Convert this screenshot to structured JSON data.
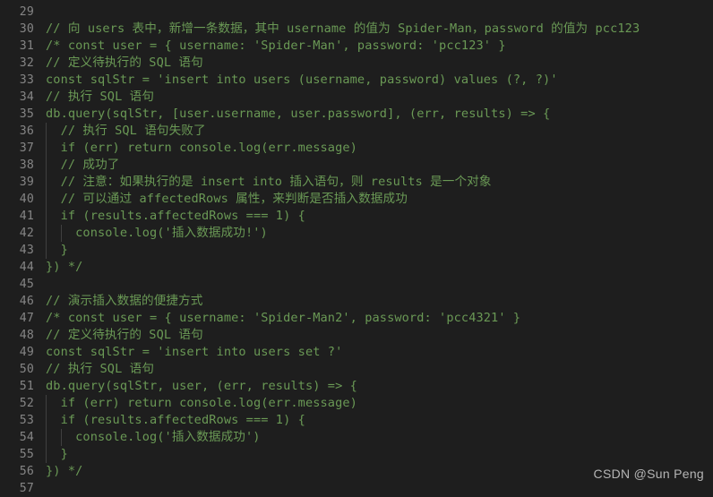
{
  "editor": {
    "theme": "dark-plus",
    "background_color": "#1e1e1e",
    "comment_color": "#6a9955",
    "line_number_color": "#858585",
    "indent_guide_color": "#404040",
    "first_line_number": 29,
    "lines": [
      {
        "number": "29",
        "text": "",
        "indent_guides": 0
      },
      {
        "number": "30",
        "text": "// 向 users 表中，新增一条数据，其中 username 的值为 Spider-Man，password 的值为 pcc123",
        "indent_guides": 0
      },
      {
        "number": "31",
        "text": "/* const user = { username: 'Spider-Man', password: 'pcc123' }",
        "indent_guides": 0
      },
      {
        "number": "32",
        "text": "// 定义待执行的 SQL 语句",
        "indent_guides": 0
      },
      {
        "number": "33",
        "text": "const sqlStr = 'insert into users (username, password) values (?, ?)'",
        "indent_guides": 0
      },
      {
        "number": "34",
        "text": "// 执行 SQL 语句",
        "indent_guides": 0
      },
      {
        "number": "35",
        "text": "db.query(sqlStr, [user.username, user.password], (err, results) => {",
        "indent_guides": 0
      },
      {
        "number": "36",
        "text": "  // 执行 SQL 语句失败了",
        "indent_guides": 1
      },
      {
        "number": "37",
        "text": "  if (err) return console.log(err.message)",
        "indent_guides": 1
      },
      {
        "number": "38",
        "text": "  // 成功了",
        "indent_guides": 1
      },
      {
        "number": "39",
        "text": "  // 注意：如果执行的是 insert into 插入语句，则 results 是一个对象",
        "indent_guides": 1
      },
      {
        "number": "40",
        "text": "  // 可以通过 affectedRows 属性，来判断是否插入数据成功",
        "indent_guides": 1
      },
      {
        "number": "41",
        "text": "  if (results.affectedRows === 1) {",
        "indent_guides": 1
      },
      {
        "number": "42",
        "text": "    console.log('插入数据成功!')",
        "indent_guides": 2
      },
      {
        "number": "43",
        "text": "  }",
        "indent_guides": 1
      },
      {
        "number": "44",
        "text": "}) */",
        "indent_guides": 0
      },
      {
        "number": "45",
        "text": "",
        "indent_guides": 0
      },
      {
        "number": "46",
        "text": "// 演示插入数据的便捷方式",
        "indent_guides": 0
      },
      {
        "number": "47",
        "text": "/* const user = { username: 'Spider-Man2', password: 'pcc4321' }",
        "indent_guides": 0
      },
      {
        "number": "48",
        "text": "// 定义待执行的 SQL 语句",
        "indent_guides": 0
      },
      {
        "number": "49",
        "text": "const sqlStr = 'insert into users set ?'",
        "indent_guides": 0
      },
      {
        "number": "50",
        "text": "// 执行 SQL 语句",
        "indent_guides": 0
      },
      {
        "number": "51",
        "text": "db.query(sqlStr, user, (err, results) => {",
        "indent_guides": 0
      },
      {
        "number": "52",
        "text": "  if (err) return console.log(err.message)",
        "indent_guides": 1
      },
      {
        "number": "53",
        "text": "  if (results.affectedRows === 1) {",
        "indent_guides": 1
      },
      {
        "number": "54",
        "text": "    console.log('插入数据成功')",
        "indent_guides": 2
      },
      {
        "number": "55",
        "text": "  }",
        "indent_guides": 1
      },
      {
        "number": "56",
        "text": "}) */",
        "indent_guides": 0
      },
      {
        "number": "57",
        "text": "",
        "indent_guides": 0
      }
    ]
  },
  "watermark": {
    "text": "CSDN @Sun  Peng"
  }
}
